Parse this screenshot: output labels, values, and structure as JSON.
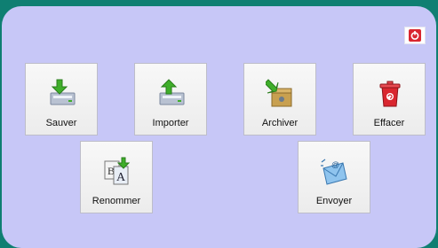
{
  "actions": {
    "sauver": "Sauver",
    "importer": "Importer",
    "archiver": "Archiver",
    "effacer": "Effacer",
    "renommer": "Renommer",
    "envoyer": "Envoyer"
  },
  "icons": {
    "close": "power-icon",
    "sauver": "save-drive-icon",
    "importer": "import-drive-icon",
    "archiver": "archive-box-icon",
    "effacer": "trash-icon",
    "renommer": "rename-icon",
    "envoyer": "send-email-icon"
  },
  "colors": {
    "background": "#0f7f72",
    "panel": "#c7c7f7",
    "accent_green": "#3fae2a",
    "accent_red": "#d9262f"
  }
}
